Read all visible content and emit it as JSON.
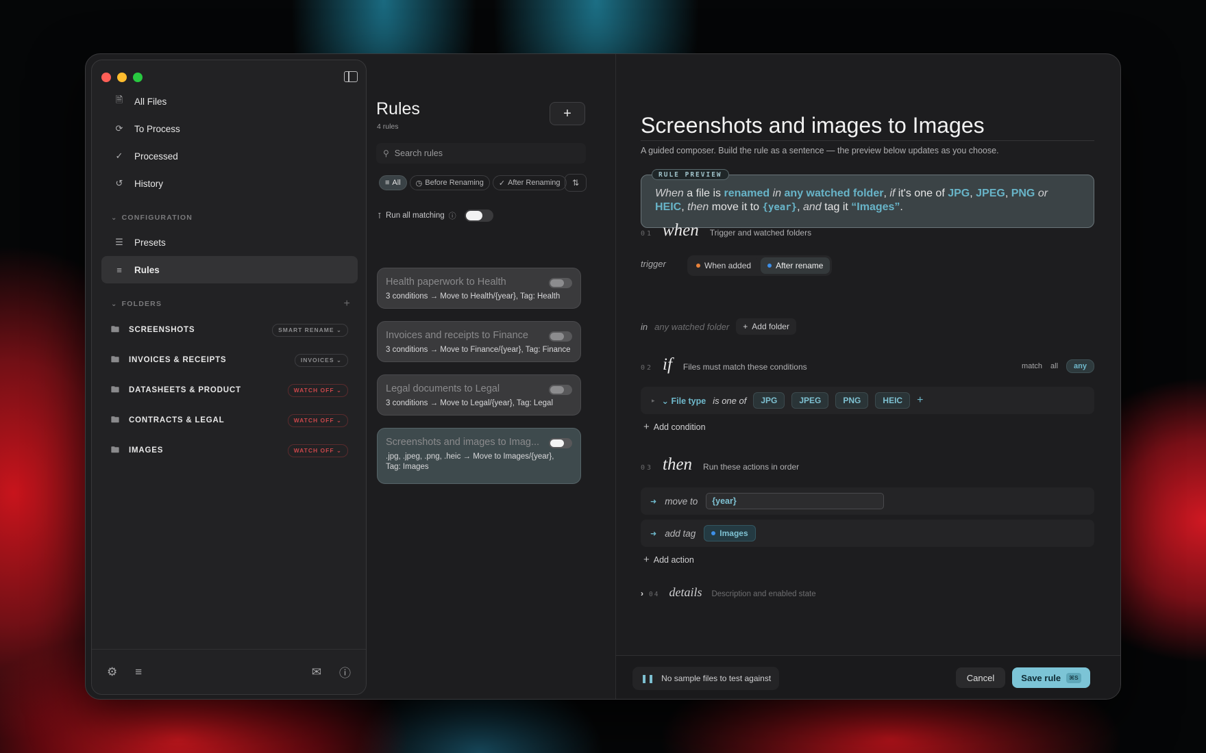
{
  "sidebar": {
    "nav": [
      {
        "label": "All Files",
        "icon": "document-icon"
      },
      {
        "label": "To Process",
        "icon": "refresh-icon"
      },
      {
        "label": "Processed",
        "icon": "check-circle-icon"
      },
      {
        "label": "History",
        "icon": "history-icon"
      }
    ],
    "config_heading": "CONFIGURATION",
    "config": [
      {
        "label": "Presets",
        "icon": "layers-icon"
      },
      {
        "label": "Rules",
        "icon": "sliders-icon",
        "active": true
      }
    ],
    "folders_heading": "FOLDERS",
    "folders": [
      {
        "name": "SCREENSHOTS",
        "badge": "SMART RENAME",
        "off": false
      },
      {
        "name": "INVOICES & RECEIPTS",
        "badge": "INVOICES",
        "off": false
      },
      {
        "name": "DATASHEETS & PRODUCT",
        "badge": "WATCH OFF",
        "off": true
      },
      {
        "name": "CONTRACTS & LEGAL",
        "badge": "WATCH OFF",
        "off": true
      },
      {
        "name": "IMAGES",
        "badge": "WATCH OFF",
        "off": true
      }
    ]
  },
  "rules": {
    "title": "Rules",
    "count": "4 rules",
    "search_placeholder": "Search rules",
    "filters": [
      "All",
      "Before Renaming",
      "After Renaming"
    ],
    "run_all_label": "Run all matching",
    "items": [
      {
        "name": "Health paperwork to Health",
        "desc": "3 conditions → Move to Health/{year}, Tag: Health"
      },
      {
        "name": "Invoices and receipts to Finance",
        "desc": "3 conditions → Move to Finance/{year}, Tag: Finance"
      },
      {
        "name": "Legal documents to Legal",
        "desc": "3 conditions → Move to Legal/{year}, Tag: Legal"
      },
      {
        "name": "Screenshots and images to Imag...",
        "desc": ".jpg, .jpeg, .png, .heic → Move to Images/{year}, Tag: Images",
        "active": true
      }
    ]
  },
  "composer": {
    "title": "Screenshots and images to Images",
    "subtitle": "A guided composer. Build the rule as a sentence — the preview below updates as you choose.",
    "preview_label": "RULE PREVIEW",
    "preview": {
      "p1": "When",
      "p2": " a file is ",
      "p3": "renamed",
      "p4": " in ",
      "p5": "any watched folder",
      "p6": ", ",
      "p7": "if",
      "p8": " it's one of ",
      "p9": "JPG",
      "p10": ", ",
      "p11": "JPEG",
      "p12": ", ",
      "p13": "PNG",
      "p14": " or ",
      "p15": "HEIC",
      "p16": ", ",
      "p17": "then",
      "p18": " move it to ",
      "p19": "{year}",
      "p20": ", ",
      "p21": "and",
      "p22": " tag it ",
      "p23": "“Images”",
      "p24": "."
    },
    "when": {
      "num": "01",
      "word": "when",
      "desc": "Trigger and watched folders",
      "trigger_label": "trigger",
      "triggers": [
        "When added",
        "After rename"
      ],
      "in_label": "in",
      "in_value": "any watched folder",
      "add_folder": "Add folder"
    },
    "if": {
      "num": "02",
      "word": "if",
      "desc": "Files must match these conditions",
      "match_label": "match",
      "match_all": "all",
      "match_any": "any",
      "field": "File type",
      "op": "is one of",
      "values": [
        "JPG",
        "JPEG",
        "PNG",
        "HEIC"
      ],
      "add_condition": "Add condition"
    },
    "then": {
      "num": "03",
      "word": "then",
      "desc": "Run these actions in order",
      "move_label": "move to",
      "move_value": "{year}",
      "tag_label": "add tag",
      "tag_value": "Images",
      "add_action": "Add action"
    },
    "details": {
      "num": "04",
      "word": "details",
      "desc": "Description and enabled state"
    },
    "footer": {
      "sample": "No sample files to test against",
      "cancel": "Cancel",
      "save": "Save rule",
      "save_kbd": "⌘S"
    }
  },
  "colors": {
    "accent": "#7cc4d6",
    "keyword": "#68b4c8",
    "warn": "#c9464a",
    "orange_dot": "#e8823a",
    "blue_dot": "#3d8fe8"
  }
}
